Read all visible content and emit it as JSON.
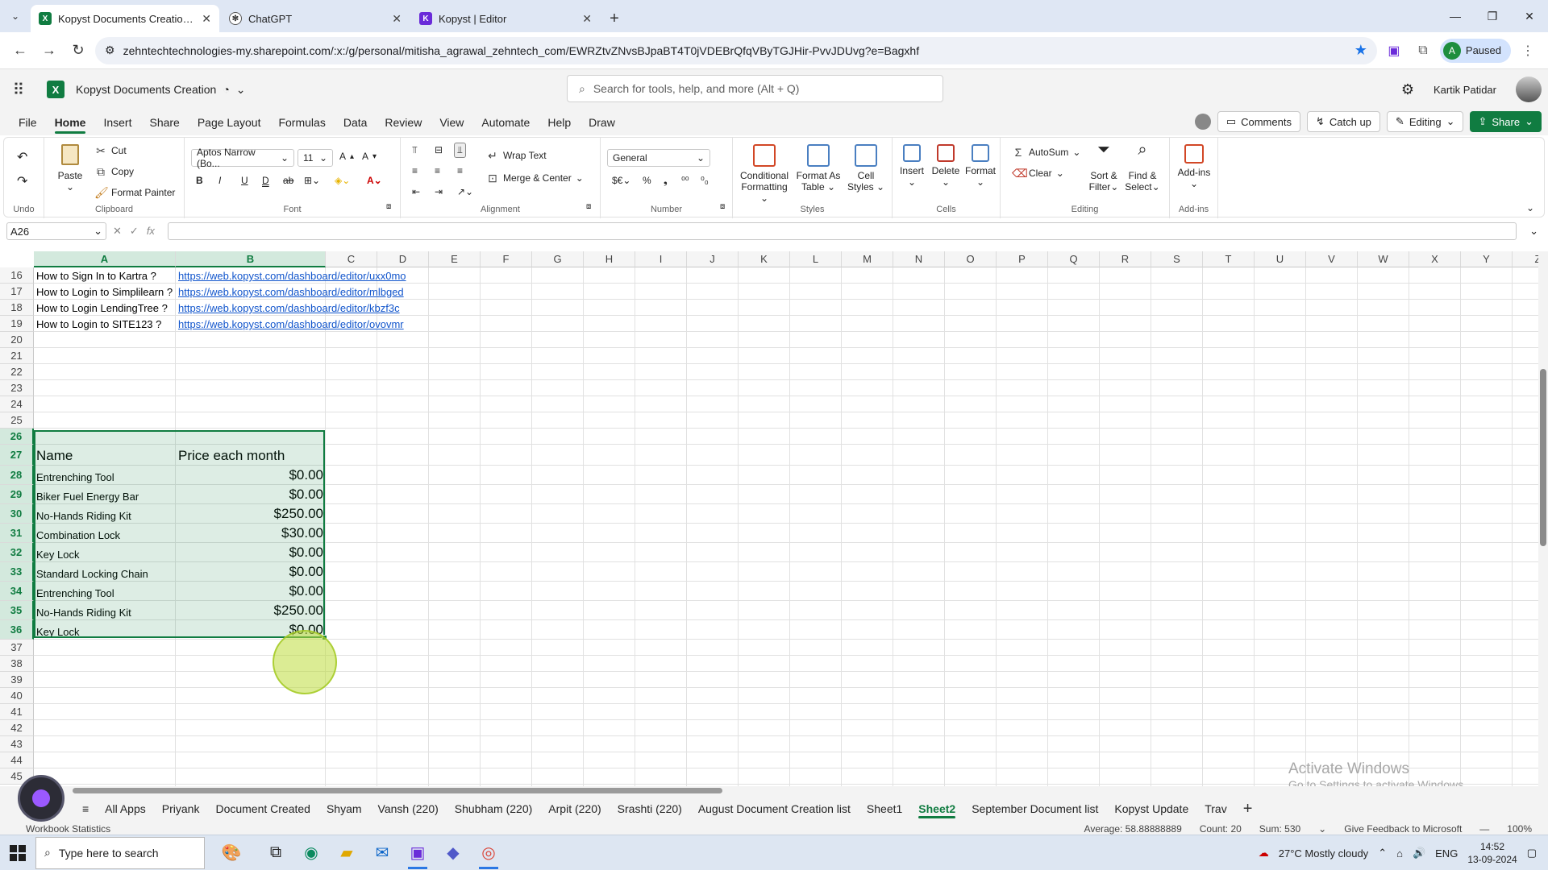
{
  "browser": {
    "tabs": [
      {
        "label": "Kopyst Documents Creation.xlsx",
        "icon": "excel-icon",
        "active": true
      },
      {
        "label": "ChatGPT",
        "icon": "chatgpt-icon",
        "active": false
      },
      {
        "label": "Kopyst | Editor",
        "icon": "kopyst-icon",
        "active": false
      }
    ],
    "url": "zehntechtechnologies-my.sharepoint.com/:x:/g/personal/mitisha_agrawal_zehntech_com/EWRZtvZNvsBJpaBT4T0jVDEBrQfqVByTGJHir-PvvJDUvg?e=Bagxhf",
    "profile_initial": "A",
    "profile_label": "Paused"
  },
  "excel": {
    "doc_title": "Kopyst Documents Creation",
    "search_placeholder": "Search for tools, help, and more (Alt + Q)",
    "user_name": "Kartik Patidar",
    "menus": [
      "File",
      "Home",
      "Insert",
      "Share",
      "Page Layout",
      "Formulas",
      "Data",
      "Review",
      "View",
      "Automate",
      "Help",
      "Draw"
    ],
    "active_menu": "Home",
    "comments_label": "Comments",
    "catchup_label": "Catch up",
    "editing_label": "Editing",
    "share_label": "Share"
  },
  "ribbon": {
    "undo_group": "Undo",
    "paste": "Paste",
    "cut": "Cut",
    "copy": "Copy",
    "format_painter": "Format Painter",
    "clipboard_group": "Clipboard",
    "font_name": "Aptos Narrow (Bo...",
    "font_size": "11",
    "font_group": "Font",
    "wrap_text": "Wrap Text",
    "merge_center": "Merge & Center",
    "alignment_group": "Alignment",
    "number_format": "General",
    "number_group": "Number",
    "conditional_formatting_1": "Conditional",
    "conditional_formatting_2": "Formatting",
    "format_as_table_1": "Format As",
    "format_as_table_2": "Table",
    "cell_styles_1": "Cell",
    "cell_styles_2": "Styles",
    "styles_group": "Styles",
    "insert": "Insert",
    "delete": "Delete",
    "format": "Format",
    "cells_group": "Cells",
    "autosum": "AutoSum",
    "clear": "Clear",
    "sort_filter_1": "Sort &",
    "sort_filter_2": "Filter",
    "find_select_1": "Find &",
    "find_select_2": "Select",
    "editing_group": "Editing",
    "addins": "Add-ins",
    "addins_group": "Add-ins"
  },
  "formula_bar": {
    "name_box": "A26",
    "formula": ""
  },
  "grid": {
    "columns": [
      "A",
      "B",
      "C",
      "D",
      "E",
      "F",
      "G",
      "H",
      "I",
      "J",
      "K",
      "L",
      "M",
      "N",
      "O",
      "P",
      "Q",
      "R",
      "S",
      "T",
      "U",
      "V",
      "W",
      "X",
      "Y",
      "Z"
    ],
    "rows": [
      "16",
      "17",
      "18",
      "19",
      "20",
      "21",
      "22",
      "23",
      "24",
      "25",
      "26",
      "27",
      "28",
      "29",
      "30",
      "31",
      "32",
      "33",
      "34",
      "35",
      "36",
      "37",
      "38",
      "39",
      "40",
      "41",
      "42",
      "43",
      "44",
      "45"
    ],
    "link_rows": [
      {
        "a": "How to Sign In to Kartra ?",
        "b": "https://web.kopyst.com/dashboard/editor/uxx0mo"
      },
      {
        "a": "How to Login to Simplilearn ?",
        "b": "https://web.kopyst.com/dashboard/editor/mlbged"
      },
      {
        "a": "How to Login LendingTree ?",
        "b": "https://web.kopyst.com/dashboard/editor/kbzf3c"
      },
      {
        "a": "How to Login to SITE123 ?",
        "b": "https://web.kopyst.com/dashboard/editor/ovovmr"
      }
    ],
    "table_header": {
      "a": "Name",
      "b": "Price each month"
    },
    "table_rows": [
      {
        "a": "Entrenching Tool",
        "b": "$0.00"
      },
      {
        "a": "Biker Fuel Energy Bar",
        "b": "$0.00"
      },
      {
        "a": "No-Hands Riding Kit",
        "b": "$250.00"
      },
      {
        "a": "Combination Lock",
        "b": "$30.00"
      },
      {
        "a": "Key Lock",
        "b": "$0.00"
      },
      {
        "a": "Standard Locking Chain",
        "b": "$0.00"
      },
      {
        "a": "Entrenching Tool",
        "b": "$0.00"
      },
      {
        "a": "No-Hands Riding Kit",
        "b": "$250.00"
      },
      {
        "a": "Key Lock",
        "b": "$0.00"
      }
    ]
  },
  "watermark": {
    "line1": "Activate Windows",
    "line2": "Go to Settings to activate Windows."
  },
  "sheets": [
    "All Apps",
    "Priyank",
    "Document Created",
    "Shyam",
    "Vansh (220)",
    "Shubham (220)",
    "Arpit (220)",
    "Srashti (220)",
    "August Document Creation list",
    "Sheet1",
    "Sheet2",
    "September Document list",
    "Kopyst Update",
    "Trav"
  ],
  "active_sheet": "Sheet2",
  "status": {
    "left": "Workbook Statistics",
    "average": "Average: 58.88888889",
    "count": "Count: 20",
    "sum": "Sum: 530",
    "feedback": "Give Feedback to Microsoft",
    "zoom": "100%"
  },
  "taskbar": {
    "search_placeholder": "Type here to search",
    "weather": "27°C  Mostly cloudy",
    "lang": "ENG",
    "time": "14:52",
    "date": "13-09-2024"
  }
}
